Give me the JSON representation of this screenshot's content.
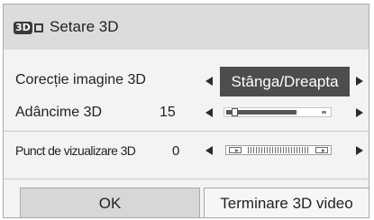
{
  "dialog": {
    "title": "Setare 3D",
    "icon": "3d-mode-icon",
    "icon_badge": "3D"
  },
  "rows": [
    {
      "label": "Corecție imagine 3D",
      "value": "Stânga/Dreapta"
    },
    {
      "label": "Adâncime 3D",
      "value": "15"
    },
    {
      "label": "Punct de vizualizare 3D",
      "value": "0"
    }
  ],
  "buttons": {
    "ok": "OK",
    "end_3d": "Terminare 3D video"
  },
  "colors": {
    "selection": "#4d4d4d",
    "title_bar": "#dcdcdc",
    "panel": "#f3f3f3"
  }
}
